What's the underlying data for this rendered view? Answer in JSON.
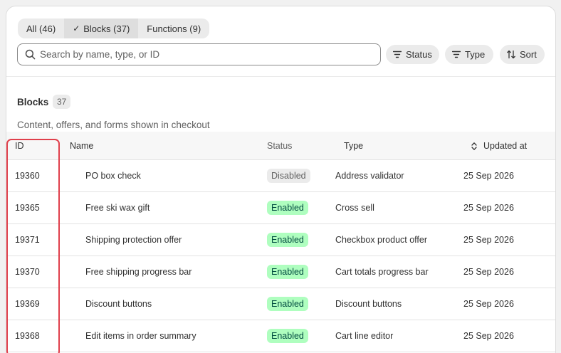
{
  "tabs": [
    {
      "label": "All (46)",
      "selected": false
    },
    {
      "label": "Blocks (37)",
      "selected": true,
      "check": "✓"
    },
    {
      "label": "Functions (9)",
      "selected": false
    }
  ],
  "search": {
    "placeholder": "Search by name, type, or ID",
    "value": ""
  },
  "filters": {
    "status_label": "Status",
    "type_label": "Type",
    "sort_label": "Sort"
  },
  "section": {
    "title": "Blocks",
    "count": "37",
    "description": "Content, offers, and forms shown in checkout"
  },
  "table": {
    "headers": {
      "id": "ID",
      "name": "Name",
      "status": "Status",
      "type": "Type",
      "updated": "Updated at"
    },
    "rows": [
      {
        "id": "19360",
        "name": "PO box check",
        "status": "Disabled",
        "type": "Address validator",
        "updated": "25 Sep 2026"
      },
      {
        "id": "19365",
        "name": "Free ski wax gift",
        "status": "Enabled",
        "type": "Cross sell",
        "updated": "25 Sep 2026"
      },
      {
        "id": "19371",
        "name": "Shipping protection offer",
        "status": "Enabled",
        "type": "Checkbox product offer",
        "updated": "25 Sep 2026"
      },
      {
        "id": "19370",
        "name": "Free shipping progress bar",
        "status": "Enabled",
        "type": "Cart totals progress bar",
        "updated": "25 Sep 2026"
      },
      {
        "id": "19369",
        "name": "Discount buttons",
        "status": "Enabled",
        "type": "Discount buttons",
        "updated": "25 Sep 2026"
      },
      {
        "id": "19368",
        "name": "Edit items in order summary",
        "status": "Enabled",
        "type": "Cart line editor",
        "updated": "25 Sep 2026"
      }
    ]
  },
  "colors": {
    "enabled_bg": "#affebf",
    "disabled_bg": "#ebebeb",
    "highlight": "#e0404c"
  },
  "icons": {
    "search": "search-icon",
    "filter": "filter-icon",
    "sort": "sort-icon",
    "sort_indicator": "sort-updown-icon"
  }
}
